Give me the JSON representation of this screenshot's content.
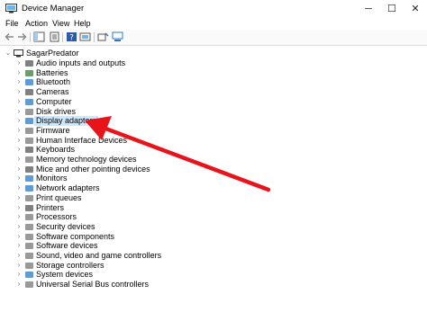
{
  "window": {
    "title": "Device Manager",
    "minimize": "─",
    "maximize": "☐",
    "close": "✕"
  },
  "menu": [
    "File",
    "Action",
    "View",
    "Help"
  ],
  "toolbar": [
    "back-icon",
    "forward-icon",
    "properties-icon",
    "help-icon",
    "update-driver-icon",
    "scan-icon",
    "monitor-icon"
  ],
  "tree": {
    "root": "SagarPredator",
    "items": [
      "Audio inputs and outputs",
      "Batteries",
      "Bluetooth",
      "Cameras",
      "Computer",
      "Disk drives",
      "Display adapters",
      "Firmware",
      "Human Interface Devices",
      "Keyboards",
      "Memory technology devices",
      "Mice and other pointing devices",
      "Monitors",
      "Network adapters",
      "Print queues",
      "Printers",
      "Processors",
      "Security devices",
      "Software components",
      "Software devices",
      "Sound, video and game controllers",
      "Storage controllers",
      "System devices",
      "Universal Serial Bus controllers"
    ]
  },
  "colors": {
    "arrow": "#e8141c",
    "selection": "#cce8ff",
    "icon_blue": "#2b79c9"
  }
}
